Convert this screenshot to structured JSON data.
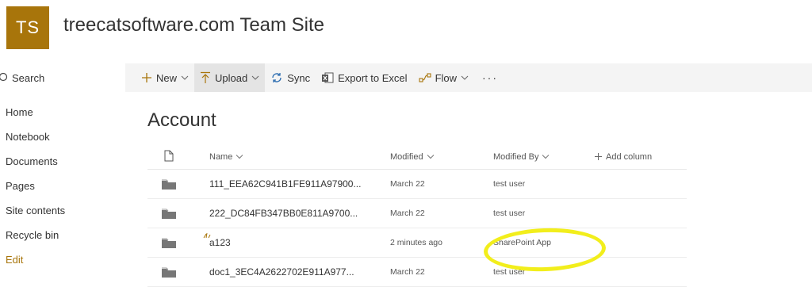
{
  "site": {
    "logo_initials": "TS",
    "title": "treecatsoftware.com Team Site",
    "accent_color": "#a8750b"
  },
  "sidebar": {
    "search_label": "Search",
    "items": [
      {
        "label": "Home"
      },
      {
        "label": "Notebook"
      },
      {
        "label": "Documents"
      },
      {
        "label": "Pages"
      },
      {
        "label": "Site contents"
      },
      {
        "label": "Recycle bin"
      },
      {
        "label": "Edit"
      }
    ]
  },
  "command_bar": {
    "new_label": "New",
    "upload_label": "Upload",
    "sync_label": "Sync",
    "export_label": "Export to Excel",
    "flow_label": "Flow",
    "more_label": "···"
  },
  "library": {
    "title": "Account",
    "columns": {
      "name": "Name",
      "modified": "Modified",
      "modified_by": "Modified By",
      "add_column": "Add column"
    },
    "rows": [
      {
        "name": "111_EEA62C941B1FE911A97900...",
        "modified": "March 22",
        "modified_by": "test user"
      },
      {
        "name": "222_DC84FB347BB0E811A9700...",
        "modified": "March 22",
        "modified_by": "test user"
      },
      {
        "name": "a123",
        "modified": "2 minutes ago",
        "modified_by": "SharePoint App"
      },
      {
        "name": "doc1_3EC4A2622702E911A977...",
        "modified": "March 22",
        "modified_by": "test user"
      }
    ]
  },
  "annotation": {
    "highlight_color": "#f2ee1c"
  }
}
